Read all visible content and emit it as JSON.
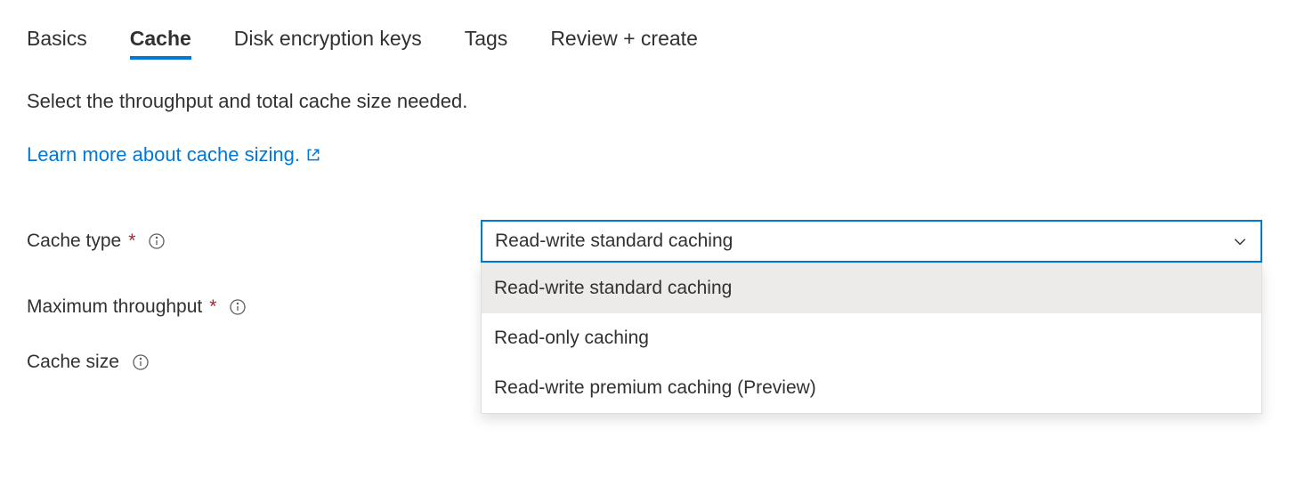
{
  "tabs": {
    "items": [
      {
        "label": "Basics",
        "active": false
      },
      {
        "label": "Cache",
        "active": true
      },
      {
        "label": "Disk encryption keys",
        "active": false
      },
      {
        "label": "Tags",
        "active": false
      },
      {
        "label": "Review + create",
        "active": false
      }
    ]
  },
  "description": "Select the throughput and total cache size needed.",
  "learn_more": "Learn more about cache sizing.",
  "fields": {
    "cache_type": {
      "label": "Cache type",
      "required": true,
      "selected": "Read-write standard caching",
      "options": [
        "Read-write standard caching",
        "Read-only caching",
        "Read-write premium caching (Preview)"
      ]
    },
    "max_throughput": {
      "label": "Maximum throughput",
      "required": true
    },
    "cache_size": {
      "label": "Cache size",
      "required": false
    }
  }
}
